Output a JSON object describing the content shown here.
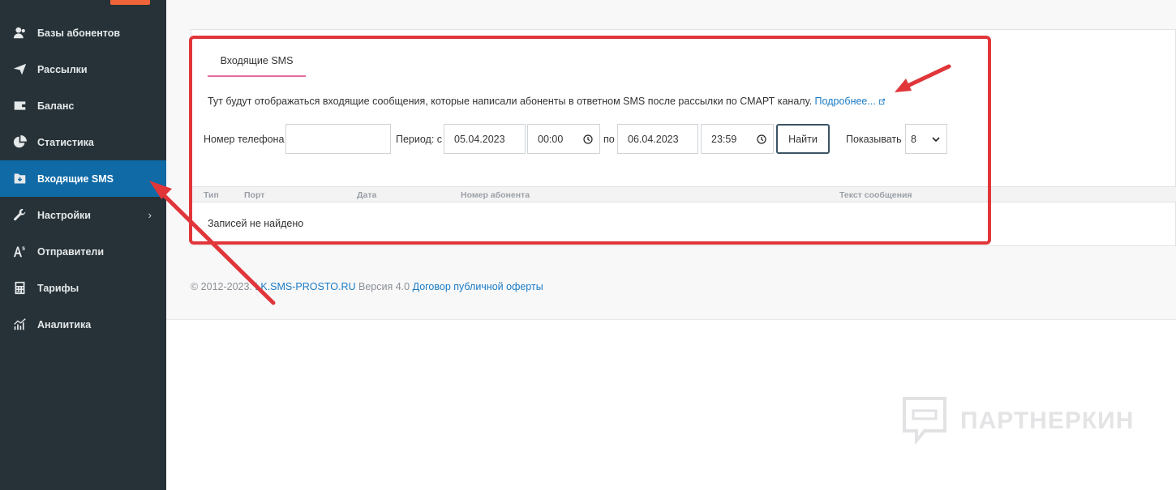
{
  "sidebar": {
    "items": [
      {
        "label": "Базы абонентов",
        "icon": "subscribers-icon"
      },
      {
        "label": "Рассылки",
        "icon": "send-icon"
      },
      {
        "label": "Баланс",
        "icon": "wallet-icon"
      },
      {
        "label": "Статистика",
        "icon": "pie-chart-icon"
      },
      {
        "label": "Входящие SMS",
        "icon": "inbox-icon",
        "active": true
      },
      {
        "label": "Настройки",
        "icon": "wrench-icon"
      },
      {
        "label": "Отправители",
        "icon": "sender-icon"
      },
      {
        "label": "Тарифы",
        "icon": "calculator-icon"
      },
      {
        "label": "Аналитика",
        "icon": "analytics-icon"
      }
    ],
    "active_color": "#0f6aa6",
    "bg_color": "#263238"
  },
  "tab": {
    "label": "Входящие SMS"
  },
  "info": {
    "text": "Тут будут отображаться входящие сообщения, которые написали абоненты в ответном SMS после рассылки по СМАРТ каналу.",
    "link": "Подробнее..."
  },
  "filters": {
    "phone_label": "Номер телефона",
    "phone_value": "",
    "period_label": "Период: с",
    "date_from": "05.04.2023",
    "time_from": "00:00",
    "to_label": "по",
    "date_to": "06.04.2023",
    "time_to": "23:59",
    "find_button": "Найти",
    "show_label": "Показывать",
    "show_value": "8"
  },
  "table": {
    "columns": [
      "Тип",
      "Порт",
      "Дата",
      "Номер абонента",
      "Текст сообщения"
    ],
    "empty_message": "Записей не найдено"
  },
  "footer": {
    "copyright": "© 2012-2023.",
    "site_link": "LK.SMS-PROSTO.RU",
    "version": "Версия 4.0",
    "offer_link": "Договор публичной оферты"
  },
  "watermark": {
    "text": "ПАРТНЕРКИН"
  },
  "annotation_color": "#e0363a"
}
